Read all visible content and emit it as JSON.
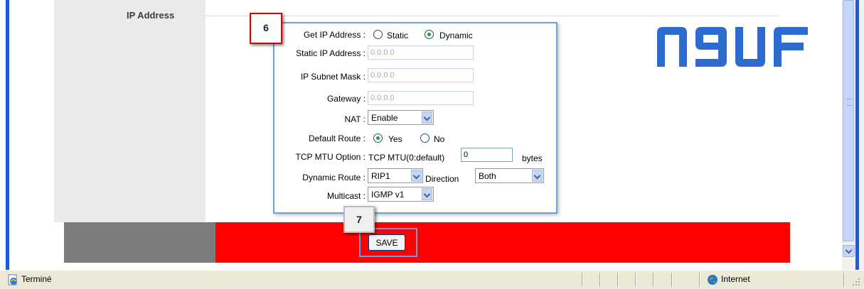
{
  "section": {
    "title": "IP Address"
  },
  "logo": {
    "text": "N9UF",
    "color": "#2e6bce"
  },
  "callouts": {
    "step6": "6",
    "step7": "7"
  },
  "form": {
    "get_ip_label": "Get IP Address :",
    "get_ip_options": [
      {
        "label": "Static",
        "checked": false
      },
      {
        "label": "Dynamic",
        "checked": true
      }
    ],
    "static_ip_label": "Static IP Address :",
    "static_ip_value": "0.0.0.0",
    "subnet_label": "IP Subnet Mask :",
    "subnet_value": "0.0.0.0",
    "gateway_label": "Gateway :",
    "gateway_value": "0.0.0.0",
    "nat_label": "NAT :",
    "nat_value": "Enable",
    "default_route_label": "Default Route :",
    "default_route_options": [
      {
        "label": "Yes",
        "checked": true
      },
      {
        "label": "No",
        "checked": false
      }
    ],
    "mtu_label": "TCP MTU Option :",
    "mtu_prefix": "TCP MTU(0:default)",
    "mtu_value": "0",
    "mtu_unit": "bytes",
    "dynamic_route_label": "Dynamic Route :",
    "dynamic_route_value": "RIP1",
    "direction_label": "Direction",
    "direction_value": "Both",
    "multicast_label": "Multicast :",
    "multicast_value": "IGMP v1"
  },
  "footer": {
    "save_label": "SAVE"
  },
  "statusbar": {
    "status": "Terminé",
    "zone": "Internet"
  },
  "colors": {
    "footer_red": "#ff0000",
    "footer_gray": "#7c7c7c",
    "panel_border": "#6f9fdc",
    "callout_border": "#e00000"
  }
}
